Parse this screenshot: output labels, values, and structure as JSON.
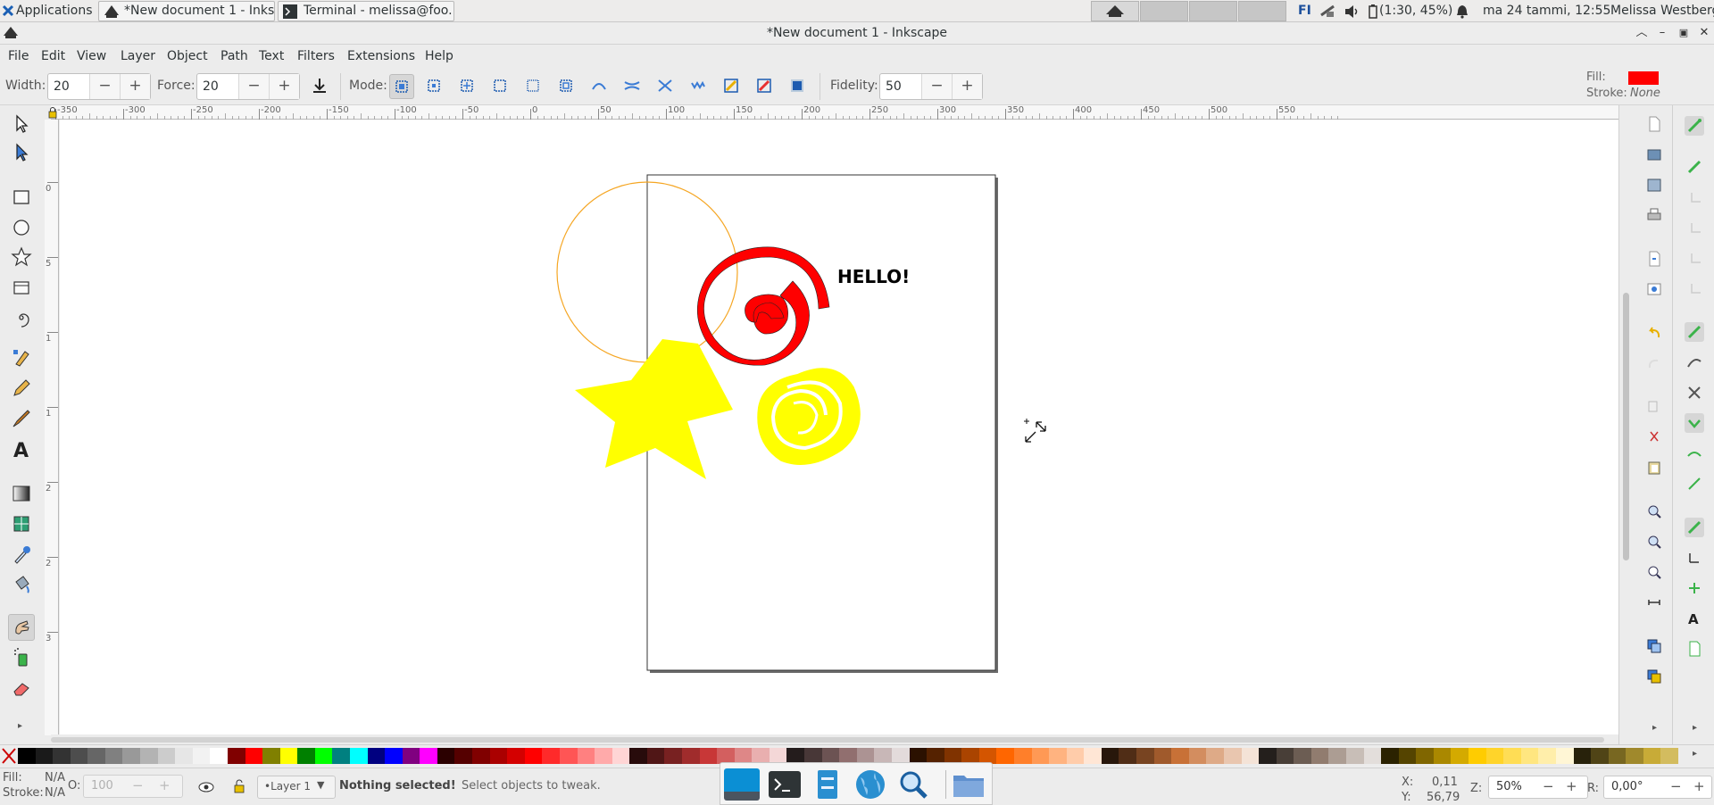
{
  "top_panel": {
    "applications_label": "Applications",
    "tasks": [
      {
        "label": "*New document 1 - Inks...",
        "icon": "inkscape-icon"
      },
      {
        "label": "Terminal - melissa@foo...",
        "icon": "terminal-icon"
      }
    ],
    "keyboard_layout": "FI",
    "battery": "(1:30, 45%)",
    "clock": "ma 24 tammi, 12:55",
    "user": "Melissa Westberg"
  },
  "window": {
    "title": "*New document 1 - Inkscape"
  },
  "menubar": {
    "items": [
      "File",
      "Edit",
      "View",
      "Layer",
      "Object",
      "Path",
      "Text",
      "Filters",
      "Extensions",
      "Help"
    ]
  },
  "tool_controls": {
    "width_label": "Width:",
    "width_value": "20",
    "force_label": "Force:",
    "force_value": "20",
    "mode_label": "Mode:",
    "fidelity_label": "Fidelity:",
    "fidelity_value": "50",
    "fill_label": "Fill:",
    "fill_color": "#ff0000",
    "stroke_label": "Stroke:",
    "stroke_value": "None"
  },
  "ruler": {
    "h_ticks": [
      "-350",
      "-300",
      "-250",
      "-200",
      "-150",
      "-100",
      "-50",
      "0",
      "50",
      "100",
      "150",
      "200",
      "250",
      "300",
      "350",
      "400",
      "450",
      "500",
      "550"
    ],
    "v_ticks": [
      "0",
      "5",
      "1",
      "1",
      "2",
      "2",
      "3"
    ]
  },
  "canvas": {
    "text_object": "HELLO!"
  },
  "palette": {
    "colors": [
      "#000000",
      "#1a1a1a",
      "#333333",
      "#4d4d4d",
      "#666666",
      "#808080",
      "#999999",
      "#b3b3b3",
      "#cccccc",
      "#e6e6e6",
      "#f2f2f2",
      "#ffffff",
      "#800000",
      "#ff0000",
      "#808000",
      "#ffff00",
      "#008000",
      "#00ff00",
      "#008080",
      "#00ffff",
      "#000080",
      "#0000ff",
      "#800080",
      "#ff00ff",
      "#2b0000",
      "#550000",
      "#800000",
      "#aa0000",
      "#d40000",
      "#ff0000",
      "#ff2a2a",
      "#ff5555",
      "#ff8080",
      "#ffaaaa",
      "#ffd5d5",
      "#280b0b",
      "#501616",
      "#782121",
      "#a02c2c",
      "#c83737",
      "#d35f5f",
      "#de8787",
      "#e9afaf",
      "#f4d7d7",
      "#241c1c",
      "#483737",
      "#6c5353",
      "#916f6f",
      "#ac9393",
      "#c8b7b7",
      "#e3dbdb",
      "#2b1100",
      "#552200",
      "#803300",
      "#aa4400",
      "#d45500",
      "#ff6600",
      "#ff7f2a",
      "#ff9955",
      "#ffb380",
      "#ffccaa",
      "#ffe6d5",
      "#28170b",
      "#502d16",
      "#784421",
      "#a05a2c",
      "#c87137",
      "#d38d5f",
      "#deaa87",
      "#e9c6af",
      "#f4e3d7",
      "#241f1c",
      "#483e37",
      "#6c5d53",
      "#917c6f",
      "#ac9d93",
      "#c8beb7",
      "#e3dedb",
      "#2b2200",
      "#554400",
      "#806600",
      "#aa8800",
      "#d4aa00",
      "#ffcc00",
      "#ffd42a",
      "#ffdd55",
      "#ffe680",
      "#ffeeaa",
      "#fff6d5",
      "#28220b",
      "#504416",
      "#786721",
      "#a0892c",
      "#c8ab37",
      "#d3bc5f"
    ]
  },
  "status": {
    "fill_label": "Fill:",
    "fill_value": "N/A",
    "stroke_label": "Stroke:",
    "stroke_value": "N/A",
    "opacity_label": "O:",
    "opacity_value": "100",
    "layer": "•Layer 1",
    "message_bold": "Nothing selected!",
    "message": "Select objects to tweak.",
    "x_label": "X:",
    "x_value": "0,11",
    "y_label": "Y:",
    "y_value": "56,79",
    "zoom_label": "Z:",
    "zoom_value": "50%",
    "rotation_label": "R:",
    "rotation_value": "0,00°"
  }
}
